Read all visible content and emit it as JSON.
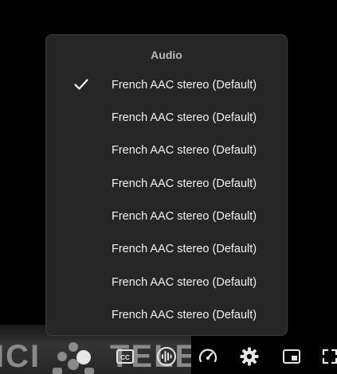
{
  "audio_menu": {
    "title": "Audio",
    "selected_index": 0,
    "items": [
      {
        "label": "French AAC stereo (Default)"
      },
      {
        "label": "French AAC stereo (Default)"
      },
      {
        "label": "French AAC stereo (Default)"
      },
      {
        "label": "French AAC stereo (Default)"
      },
      {
        "label": "French AAC stereo (Default)"
      },
      {
        "label": "French AAC stereo (Default)"
      },
      {
        "label": "French AAC stereo (Default)"
      },
      {
        "label": "French AAC stereo (Default)"
      }
    ]
  },
  "watermark": {
    "left_text": "ICI",
    "right_text": "TELE"
  },
  "controls": {
    "icons": [
      "captions-icon",
      "audio-track-icon",
      "playback-speed-icon",
      "settings-gear-icon",
      "picture-in-picture-icon",
      "fullscreen-icon"
    ],
    "icon_color": "#e6e6e6"
  }
}
